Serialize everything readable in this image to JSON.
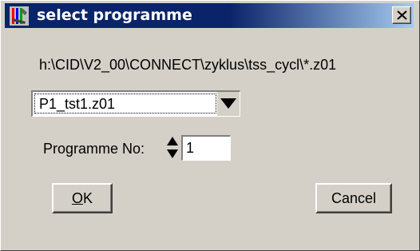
{
  "window": {
    "title": "select programme",
    "close_label": "close"
  },
  "path": {
    "text": "h:\\CID\\V2_00\\CONNECT\\zyklus\\tss_cycl\\*.z01"
  },
  "file_select": {
    "value": "P1_tst1.z01"
  },
  "programme_number": {
    "label": "Programme No:",
    "value": "1"
  },
  "buttons": {
    "ok_mnemonic": "O",
    "ok_rest": "K",
    "cancel": "Cancel"
  },
  "icons": {
    "app": "tools-icon",
    "close": "close-icon",
    "dropdown": "triangle-down-icon",
    "spin_up": "arrow-up-icon",
    "spin_down": "arrow-down-icon"
  },
  "colors": {
    "titlebar_start": "#0a246a",
    "titlebar_end": "#a6caf0",
    "face": "#d4d0c8"
  }
}
